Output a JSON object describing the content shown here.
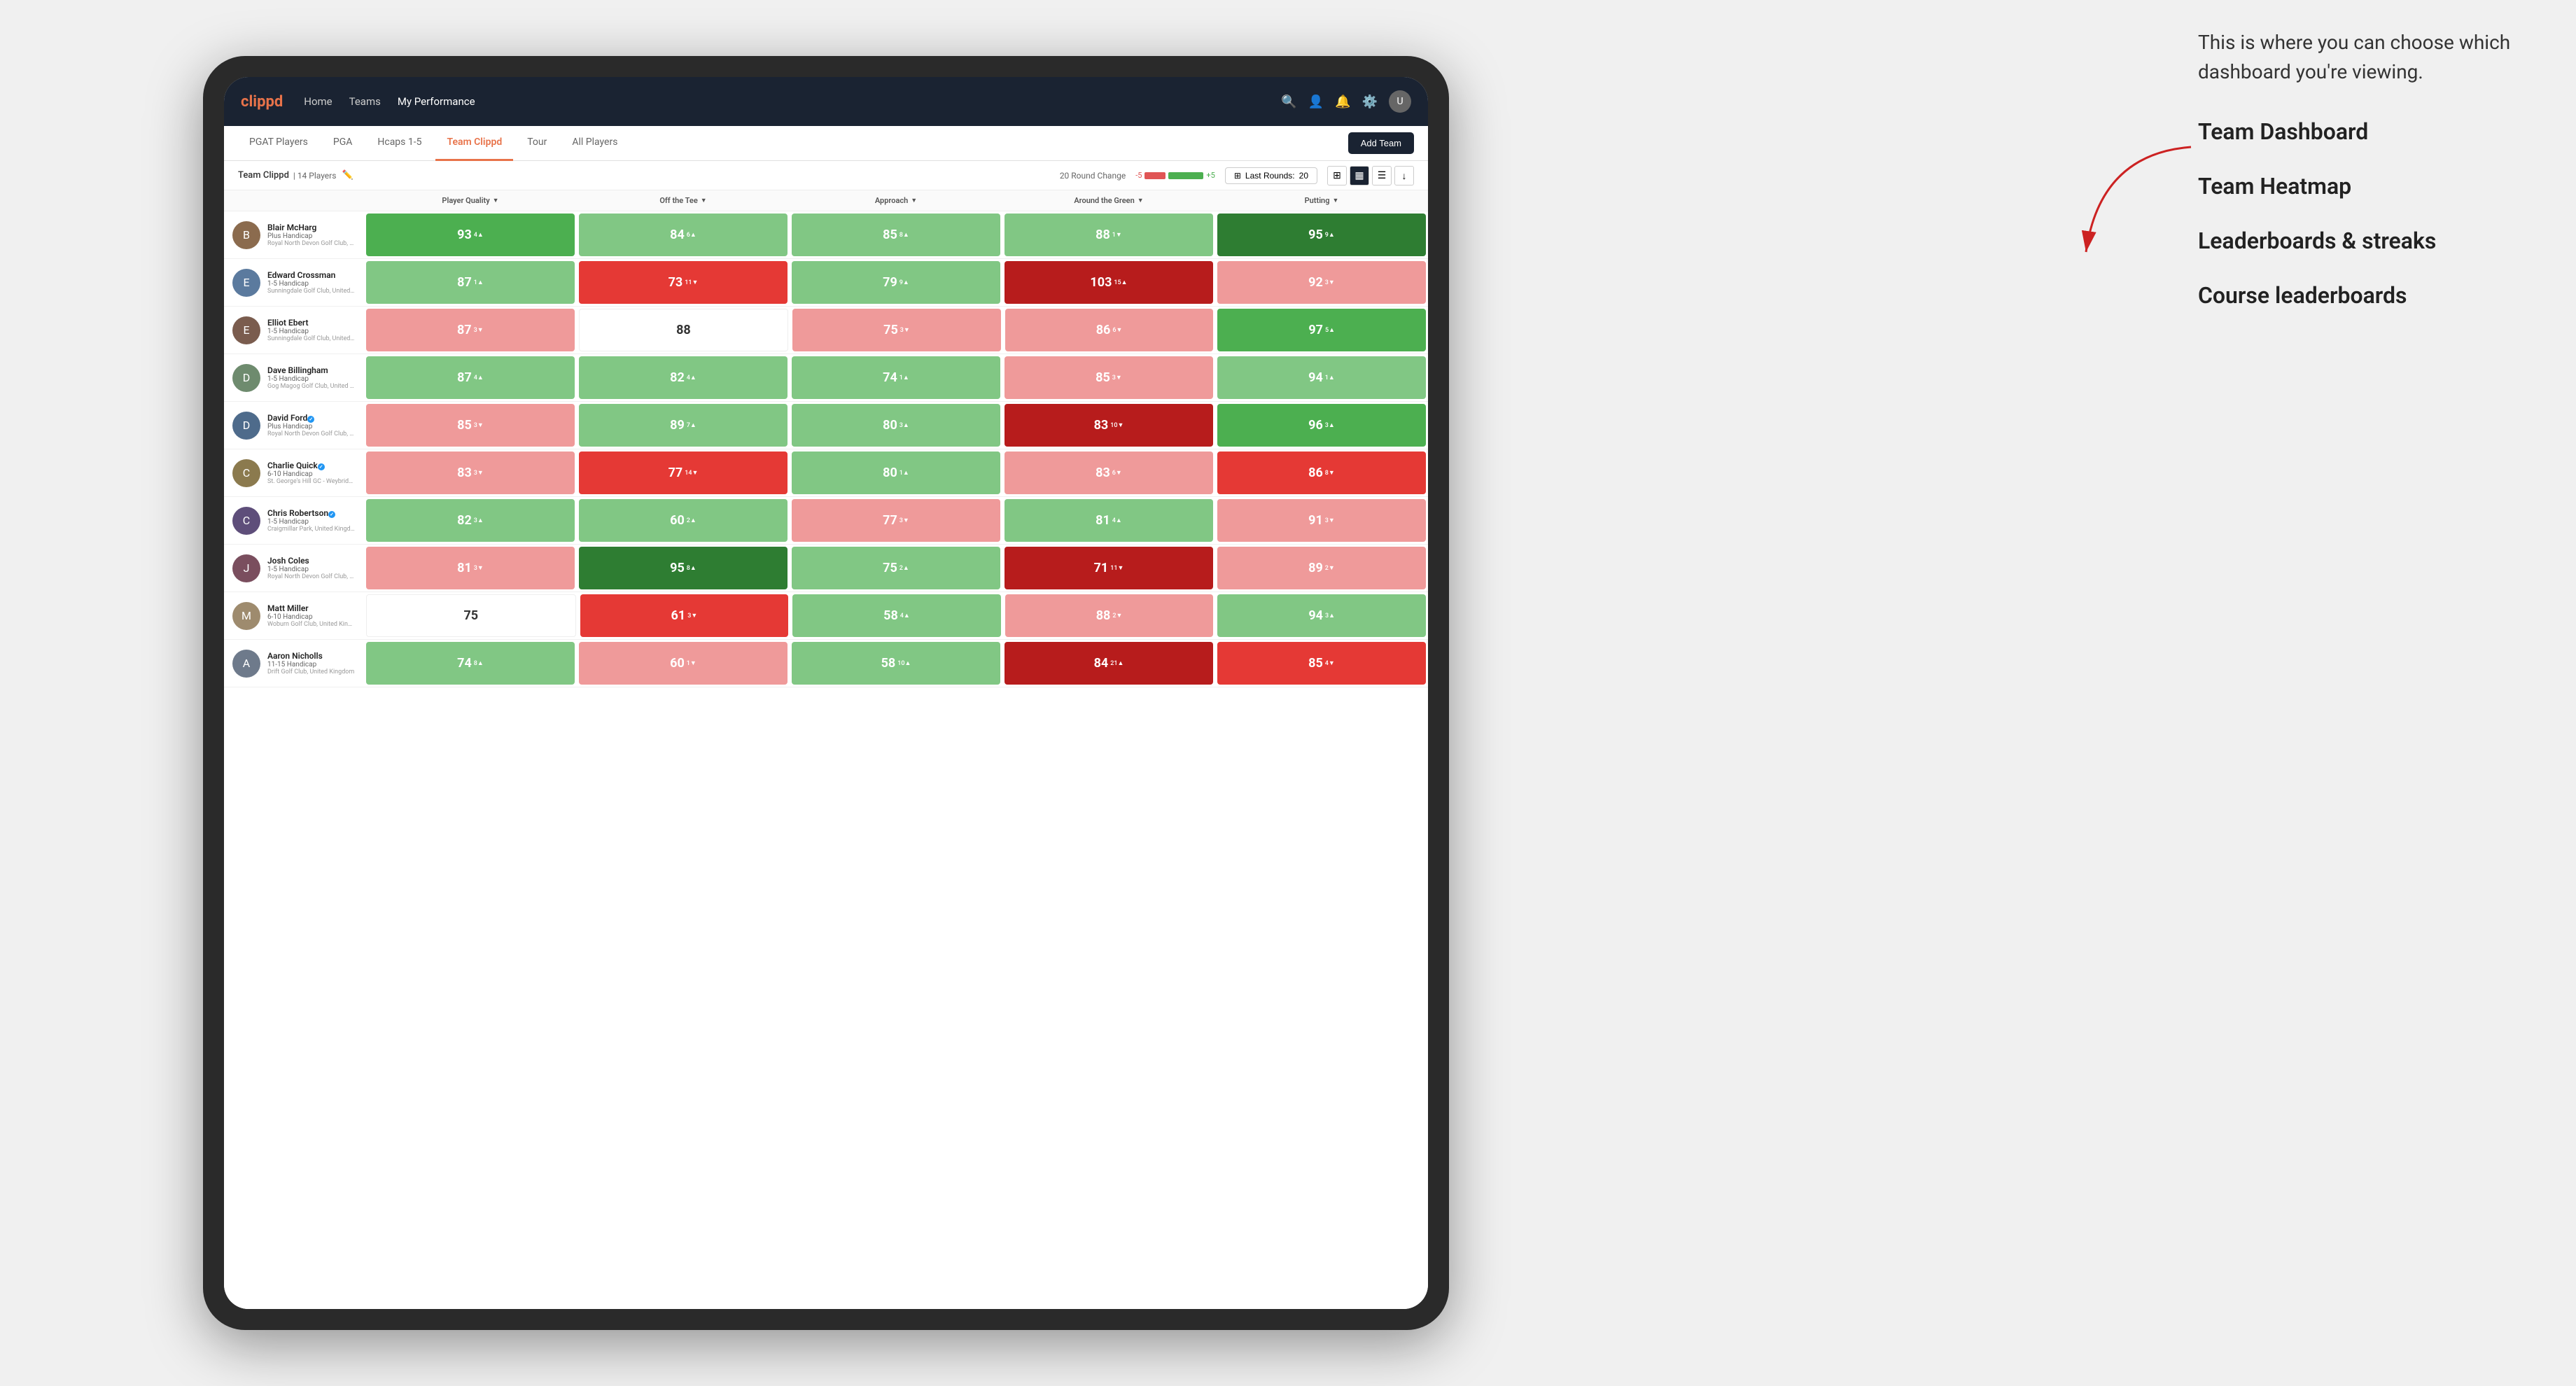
{
  "annotation": {
    "intro_text": "This is where you can choose which dashboard you're viewing.",
    "dashboard_items": [
      "Team Dashboard",
      "Team Heatmap",
      "Leaderboards & streaks",
      "Course leaderboards"
    ]
  },
  "navbar": {
    "logo": "clippd",
    "links": [
      "Home",
      "Teams",
      "My Performance"
    ],
    "active_link": "My Performance"
  },
  "tabs": {
    "items": [
      "PGAT Players",
      "PGA",
      "Hcaps 1-5",
      "Team Clippd",
      "Tour",
      "All Players"
    ],
    "active": "Team Clippd"
  },
  "toolbar": {
    "add_team_label": "Add Team",
    "team_name": "Team Clippd",
    "player_count": "14 Players",
    "round_change_label": "20 Round Change",
    "neg_val": "-5",
    "pos_val": "+5",
    "last_rounds_label": "Last Rounds:",
    "last_rounds_value": "20"
  },
  "column_headers": [
    {
      "label": "Player Quality",
      "sort": true
    },
    {
      "label": "Off the Tee",
      "sort": true
    },
    {
      "label": "Approach",
      "sort": true
    },
    {
      "label": "Around the Green",
      "sort": true
    },
    {
      "label": "Putting",
      "sort": true
    }
  ],
  "players": [
    {
      "name": "Blair McHarg",
      "handicap": "Plus Handicap",
      "club": "Royal North Devon Golf Club, United Kingdom",
      "avatar_color": "#8B6B4E",
      "metrics": [
        {
          "value": "93",
          "change": "4",
          "dir": "up",
          "color": "green-mid"
        },
        {
          "value": "84",
          "change": "6",
          "dir": "up",
          "color": "green-light"
        },
        {
          "value": "85",
          "change": "8",
          "dir": "up",
          "color": "green-light"
        },
        {
          "value": "88",
          "change": "1",
          "dir": "down",
          "color": "green-light"
        },
        {
          "value": "95",
          "change": "9",
          "dir": "up",
          "color": "green-dark"
        }
      ]
    },
    {
      "name": "Edward Crossman",
      "handicap": "1-5 Handicap",
      "club": "Sunningdale Golf Club, United Kingdom",
      "avatar_color": "#5B7A9E",
      "metrics": [
        {
          "value": "87",
          "change": "1",
          "dir": "up",
          "color": "green-light"
        },
        {
          "value": "73",
          "change": "11",
          "dir": "down",
          "color": "red-mid"
        },
        {
          "value": "79",
          "change": "9",
          "dir": "up",
          "color": "green-light"
        },
        {
          "value": "103",
          "change": "15",
          "dir": "up",
          "color": "red-dark"
        },
        {
          "value": "92",
          "change": "3",
          "dir": "down",
          "color": "red-light"
        }
      ]
    },
    {
      "name": "Elliot Ebert",
      "handicap": "1-5 Handicap",
      "club": "Sunningdale Golf Club, United Kingdom",
      "avatar_color": "#7A5C4E",
      "metrics": [
        {
          "value": "87",
          "change": "3",
          "dir": "down",
          "color": "red-light"
        },
        {
          "value": "88",
          "change": "",
          "dir": "",
          "color": "white"
        },
        {
          "value": "75",
          "change": "3",
          "dir": "down",
          "color": "red-light"
        },
        {
          "value": "86",
          "change": "6",
          "dir": "down",
          "color": "red-light"
        },
        {
          "value": "97",
          "change": "5",
          "dir": "up",
          "color": "green-mid"
        }
      ]
    },
    {
      "name": "Dave Billingham",
      "handicap": "1-5 Handicap",
      "club": "Gog Magog Golf Club, United Kingdom",
      "avatar_color": "#6E8B6E",
      "metrics": [
        {
          "value": "87",
          "change": "4",
          "dir": "up",
          "color": "green-light"
        },
        {
          "value": "82",
          "change": "4",
          "dir": "up",
          "color": "green-light"
        },
        {
          "value": "74",
          "change": "1",
          "dir": "up",
          "color": "green-light"
        },
        {
          "value": "85",
          "change": "3",
          "dir": "down",
          "color": "red-light"
        },
        {
          "value": "94",
          "change": "1",
          "dir": "up",
          "color": "green-light"
        }
      ]
    },
    {
      "name": "David Ford",
      "handicap": "Plus Handicap",
      "club": "Royal North Devon Golf Club, United Kingdom",
      "avatar_color": "#4E6B8B",
      "verified": true,
      "metrics": [
        {
          "value": "85",
          "change": "3",
          "dir": "down",
          "color": "red-light"
        },
        {
          "value": "89",
          "change": "7",
          "dir": "up",
          "color": "green-light"
        },
        {
          "value": "80",
          "change": "3",
          "dir": "up",
          "color": "green-light"
        },
        {
          "value": "83",
          "change": "10",
          "dir": "down",
          "color": "red-dark"
        },
        {
          "value": "96",
          "change": "3",
          "dir": "up",
          "color": "green-mid"
        }
      ]
    },
    {
      "name": "Charlie Quick",
      "handicap": "6-10 Handicap",
      "club": "St. George's Hill GC - Weybridge - Surrey, Uni...",
      "avatar_color": "#8B7A4E",
      "verified": true,
      "metrics": [
        {
          "value": "83",
          "change": "3",
          "dir": "down",
          "color": "red-light"
        },
        {
          "value": "77",
          "change": "14",
          "dir": "down",
          "color": "red-mid"
        },
        {
          "value": "80",
          "change": "1",
          "dir": "up",
          "color": "green-light"
        },
        {
          "value": "83",
          "change": "6",
          "dir": "down",
          "color": "red-light"
        },
        {
          "value": "86",
          "change": "8",
          "dir": "down",
          "color": "red-mid"
        }
      ]
    },
    {
      "name": "Chris Robertson",
      "handicap": "1-5 Handicap",
      "club": "Craigmillar Park, United Kingdom",
      "avatar_color": "#5E4E7A",
      "verified": true,
      "metrics": [
        {
          "value": "82",
          "change": "3",
          "dir": "up",
          "color": "green-light"
        },
        {
          "value": "60",
          "change": "2",
          "dir": "up",
          "color": "green-light"
        },
        {
          "value": "77",
          "change": "3",
          "dir": "down",
          "color": "red-light"
        },
        {
          "value": "81",
          "change": "4",
          "dir": "up",
          "color": "green-light"
        },
        {
          "value": "91",
          "change": "3",
          "dir": "down",
          "color": "red-light"
        }
      ]
    },
    {
      "name": "Josh Coles",
      "handicap": "1-5 Handicap",
      "club": "Royal North Devon Golf Club, United Kingdom",
      "avatar_color": "#7A4E5E",
      "metrics": [
        {
          "value": "81",
          "change": "3",
          "dir": "down",
          "color": "red-light"
        },
        {
          "value": "95",
          "change": "8",
          "dir": "up",
          "color": "green-dark"
        },
        {
          "value": "75",
          "change": "2",
          "dir": "up",
          "color": "green-light"
        },
        {
          "value": "71",
          "change": "11",
          "dir": "down",
          "color": "red-dark"
        },
        {
          "value": "89",
          "change": "2",
          "dir": "down",
          "color": "red-light"
        }
      ]
    },
    {
      "name": "Matt Miller",
      "handicap": "6-10 Handicap",
      "club": "Woburn Golf Club, United Kingdom",
      "avatar_color": "#9E8B6E",
      "metrics": [
        {
          "value": "75",
          "change": "",
          "dir": "",
          "color": "white"
        },
        {
          "value": "61",
          "change": "3",
          "dir": "down",
          "color": "red-mid"
        },
        {
          "value": "58",
          "change": "4",
          "dir": "up",
          "color": "green-light"
        },
        {
          "value": "88",
          "change": "2",
          "dir": "down",
          "color": "red-light"
        },
        {
          "value": "94",
          "change": "3",
          "dir": "up",
          "color": "green-light"
        }
      ]
    },
    {
      "name": "Aaron Nicholls",
      "handicap": "11-15 Handicap",
      "club": "Drift Golf Club, United Kingdom",
      "avatar_color": "#6E7A8B",
      "metrics": [
        {
          "value": "74",
          "change": "8",
          "dir": "up",
          "color": "green-light"
        },
        {
          "value": "60",
          "change": "1",
          "dir": "down",
          "color": "red-light"
        },
        {
          "value": "58",
          "change": "10",
          "dir": "up",
          "color": "green-light"
        },
        {
          "value": "84",
          "change": "21",
          "dir": "up",
          "color": "red-dark"
        },
        {
          "value": "85",
          "change": "4",
          "dir": "down",
          "color": "red-mid"
        }
      ]
    }
  ]
}
